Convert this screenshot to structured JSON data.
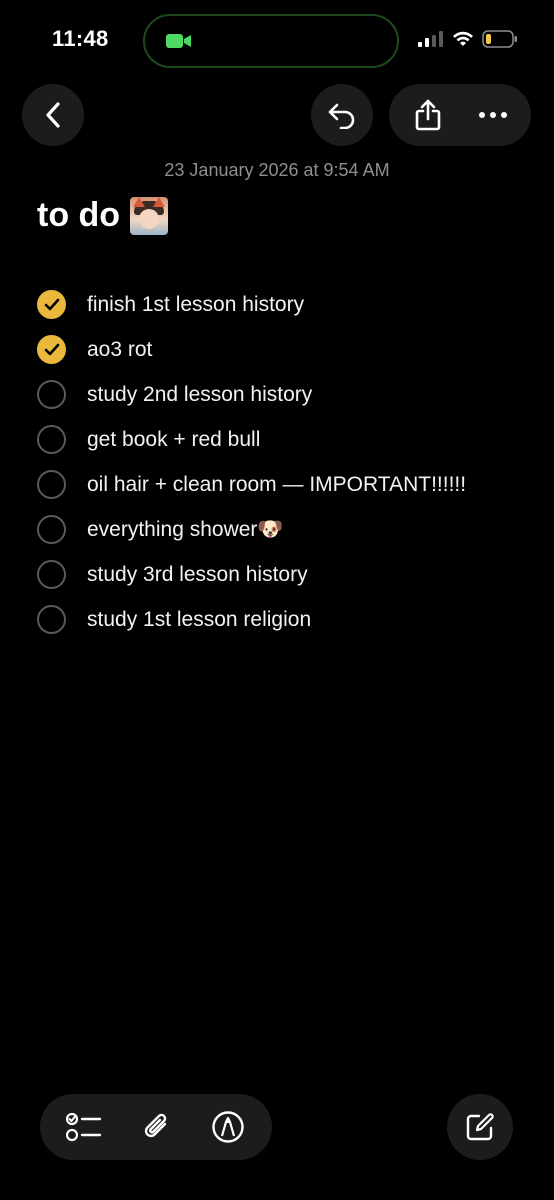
{
  "status_bar": {
    "time": "11:48",
    "signal_icon": "cellular-signal-icon",
    "wifi_icon": "wifi-icon",
    "battery_icon": "battery-low-icon",
    "facetime_icon": "facetime-video-icon",
    "facetime_color": "#4cd964",
    "battery_color": "#f2c94c"
  },
  "toolbar": {
    "back_icon": "chevron-left-icon",
    "undo_icon": "undo-icon",
    "share_icon": "share-icon",
    "more_icon": "ellipsis-icon"
  },
  "note": {
    "date": "23 January 2026 at 9:54 AM",
    "title": "to do",
    "checklist": [
      {
        "text": "finish 1st lesson history",
        "checked": true
      },
      {
        "text": "ao3 rot",
        "checked": true
      },
      {
        "text": "study 2nd lesson history",
        "checked": false
      },
      {
        "text": "get book + red bull",
        "checked": false
      },
      {
        "text": "oil hair + clean room — IMPORTANT!!!!!!",
        "checked": false
      },
      {
        "text": "everything shower🐶",
        "checked": false
      },
      {
        "text": "study 3rd lesson history",
        "checked": false
      },
      {
        "text": "study 1st lesson religion",
        "checked": false
      }
    ]
  },
  "bottom_toolbar": {
    "checklist_icon": "checklist-icon",
    "attachment_icon": "paperclip-icon",
    "markup_icon": "markup-pen-icon",
    "compose_icon": "compose-icon"
  },
  "colors": {
    "accent": "#e9b83d",
    "background": "#000000",
    "button_bg": "#1c1c1e",
    "date_text": "#8e8e93"
  }
}
